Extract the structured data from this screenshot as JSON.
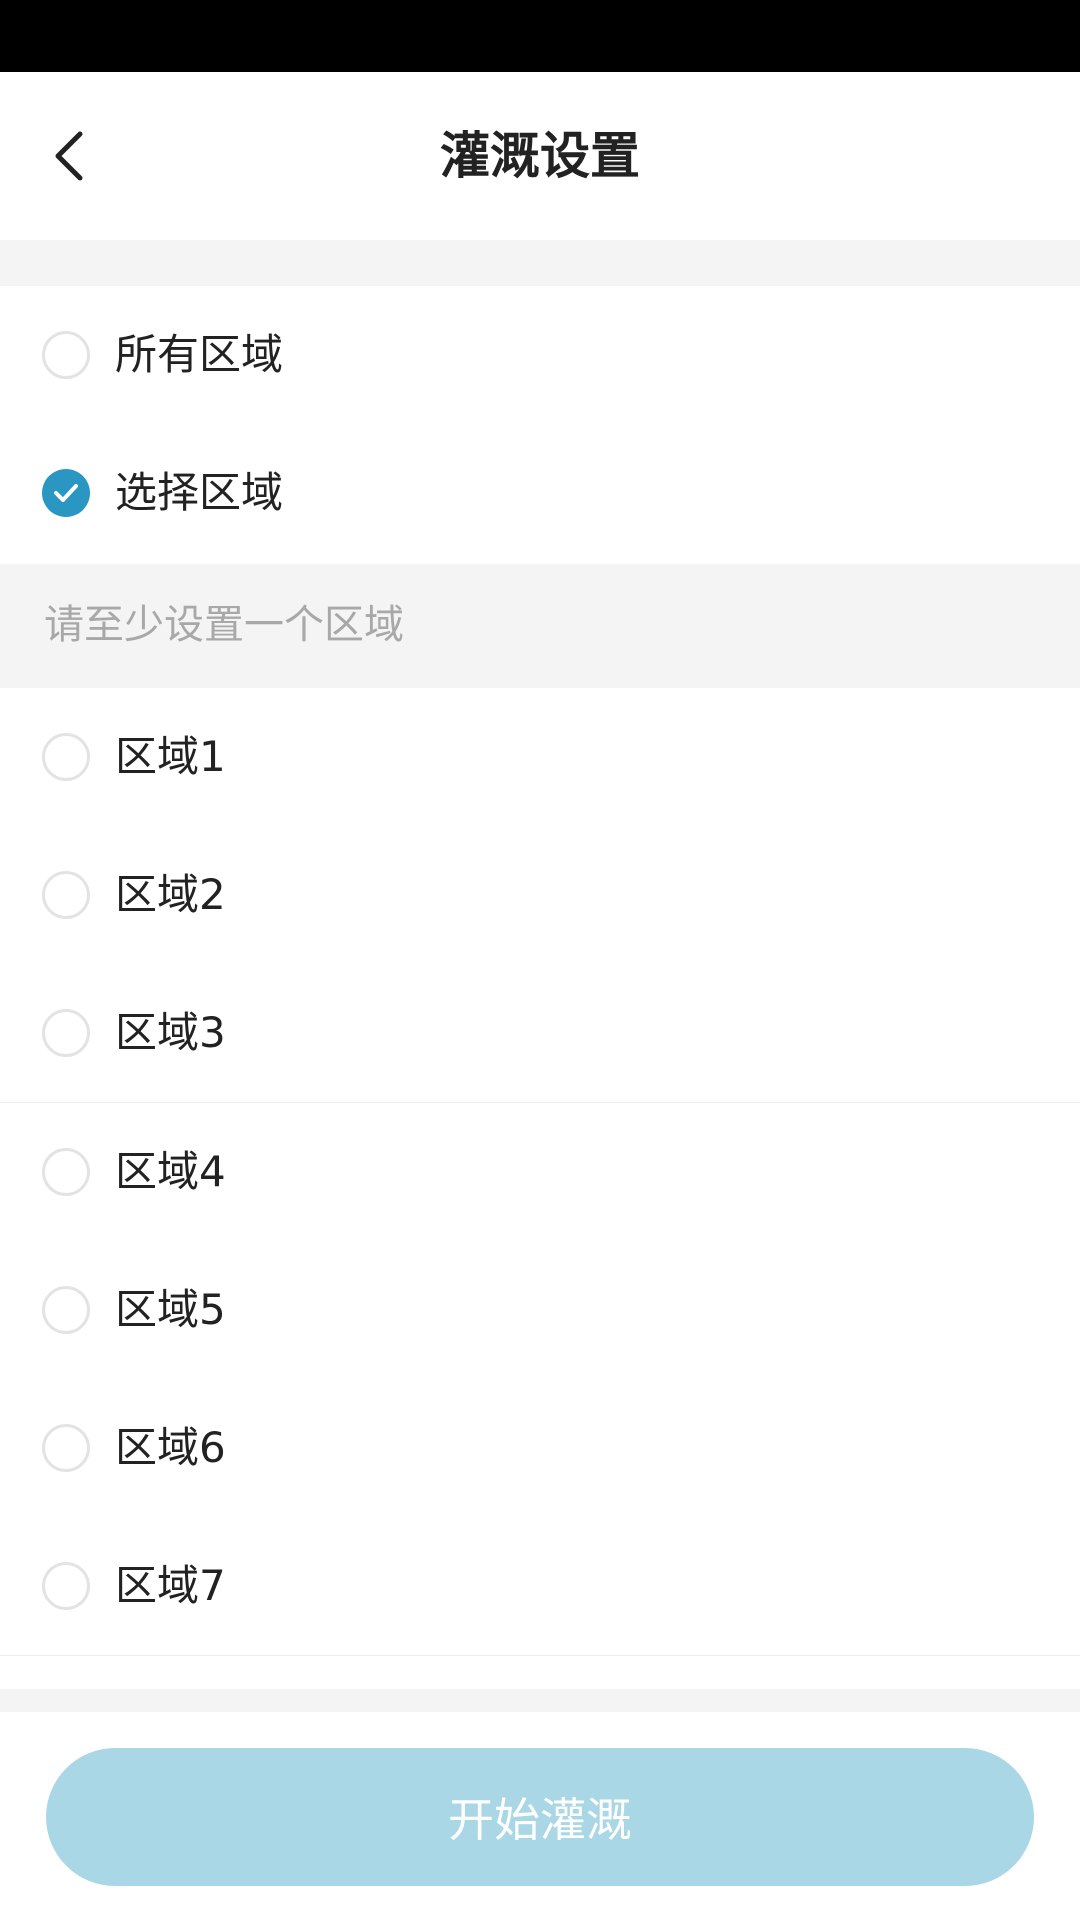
{
  "header": {
    "title": "灌溉设置",
    "back_icon": "chevron-left-icon"
  },
  "mode_options": [
    {
      "label": "所有区域",
      "checked": false
    },
    {
      "label": "选择区域",
      "checked": true
    }
  ],
  "hint": "请至少设置一个区域",
  "zones": [
    {
      "label": "区域1",
      "checked": false
    },
    {
      "label": "区域2",
      "checked": false
    },
    {
      "label": "区域3",
      "checked": false
    },
    {
      "label": "区域4",
      "checked": false
    },
    {
      "label": "区域5",
      "checked": false
    },
    {
      "label": "区域6",
      "checked": false
    },
    {
      "label": "区域7",
      "checked": false
    }
  ],
  "footer": {
    "start_label": "开始灌溉"
  },
  "colors": {
    "accent": "#2a97c3",
    "button_disabled": "#a9d7e6",
    "hint_text": "#a8a8a8",
    "band": "#f4f4f4"
  }
}
